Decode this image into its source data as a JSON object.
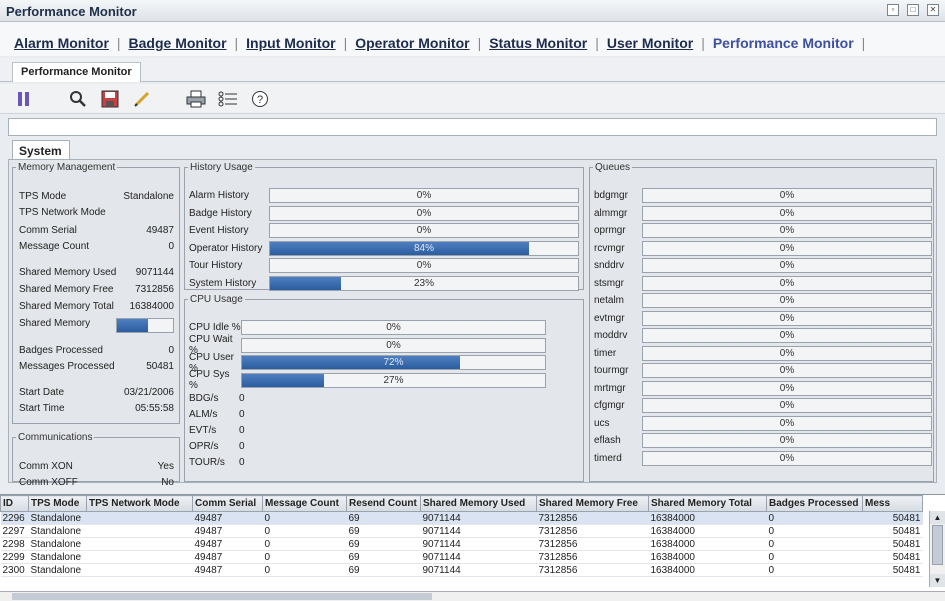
{
  "window": {
    "title": "Performance Monitor"
  },
  "nav": {
    "links": [
      "Alarm Monitor",
      "Badge Monitor",
      "Input Monitor",
      "Operator Monitor",
      "Status Monitor",
      "User Monitor",
      "Performance Monitor"
    ],
    "active": "Performance Monitor",
    "separator": "|"
  },
  "tabs": [
    {
      "label": "Performance Monitor"
    }
  ],
  "toolbar": {
    "icons": [
      "pause-icon",
      "search-icon",
      "save-icon",
      "edit-icon",
      "print-icon",
      "list-icon",
      "help-icon"
    ]
  },
  "system_tab": "System",
  "memory": {
    "legend": "Memory Management",
    "tps_mode_label": "TPS Mode",
    "tps_mode": "Standalone",
    "tps_network_mode_label": "TPS Network Mode",
    "comm_serial_label": "Comm Serial",
    "comm_serial": "49487",
    "message_count_label": "Message Count",
    "message_count": "0",
    "shm_used_label": "Shared Memory Used",
    "shm_used": "9071144",
    "shm_free_label": "Shared Memory Free",
    "shm_free": "7312856",
    "shm_total_label": "Shared Memory Total",
    "shm_total": "16384000",
    "shm_label": "Shared Memory",
    "shm_fraction": 0.55,
    "badges_label": "Badges Processed",
    "badges": "0",
    "messages_label": "Messages Processed",
    "messages": "50481",
    "start_date_label": "Start Date",
    "start_date": "03/21/2006",
    "start_time_label": "Start Time",
    "start_time": "05:55:58"
  },
  "comms": {
    "legend": "Communications",
    "xon_label": "Comm XON",
    "xon": "Yes",
    "xoff_label": "Comm XOFF",
    "xoff": "No"
  },
  "history": {
    "legend": "History Usage",
    "rows": [
      {
        "label": "Alarm History",
        "pct": "0%",
        "value": 0
      },
      {
        "label": "Badge History",
        "pct": "0%",
        "value": 0
      },
      {
        "label": "Event History",
        "pct": "0%",
        "value": 0
      },
      {
        "label": "Operator History",
        "pct": "84%",
        "value": 84
      },
      {
        "label": "Tour History",
        "pct": "0%",
        "value": 0
      },
      {
        "label": "System History",
        "pct": "23%",
        "value": 23
      }
    ]
  },
  "cpu": {
    "legend": "CPU Usage",
    "rows": [
      {
        "label": "CPU Idle %",
        "pct": "0%",
        "value": 0
      },
      {
        "label": "CPU Wait %",
        "pct": "0%",
        "value": 0
      },
      {
        "label": "CPU User %",
        "pct": "72%",
        "value": 72
      },
      {
        "label": "CPU Sys %",
        "pct": "27%",
        "value": 27
      }
    ],
    "stats": [
      {
        "label": "BDG/s",
        "value": "0"
      },
      {
        "label": "ALM/s",
        "value": "0"
      },
      {
        "label": "EVT/s",
        "value": "0"
      },
      {
        "label": "OPR/s",
        "value": "0"
      },
      {
        "label": "TOUR/s",
        "value": "0"
      }
    ]
  },
  "queues": {
    "legend": "Queues",
    "rows": [
      {
        "label": "bdgmgr",
        "pct": "0%",
        "value": 0
      },
      {
        "label": "almmgr",
        "pct": "0%",
        "value": 0
      },
      {
        "label": "oprmgr",
        "pct": "0%",
        "value": 0
      },
      {
        "label": "rcvmgr",
        "pct": "0%",
        "value": 0
      },
      {
        "label": "snddrv",
        "pct": "0%",
        "value": 0
      },
      {
        "label": "stsmgr",
        "pct": "0%",
        "value": 0
      },
      {
        "label": "netalm",
        "pct": "0%",
        "value": 0
      },
      {
        "label": "evtmgr",
        "pct": "0%",
        "value": 0
      },
      {
        "label": "moddrv",
        "pct": "0%",
        "value": 0
      },
      {
        "label": "timer",
        "pct": "0%",
        "value": 0
      },
      {
        "label": "tourmgr",
        "pct": "0%",
        "value": 0
      },
      {
        "label": "mrtmgr",
        "pct": "0%",
        "value": 0
      },
      {
        "label": "cfgmgr",
        "pct": "0%",
        "value": 0
      },
      {
        "label": "ucs",
        "pct": "0%",
        "value": 0
      },
      {
        "label": "eflash",
        "pct": "0%",
        "value": 0
      },
      {
        "label": "timerd",
        "pct": "0%",
        "value": 0
      }
    ]
  },
  "table": {
    "columns": [
      "ID",
      "TPS Mode",
      "TPS Network Mode",
      "Comm Serial",
      "Message Count",
      "Resend Count",
      "Shared Memory Used",
      "Shared Memory Free",
      "Shared Memory Total",
      "Badges Processed",
      "Mess"
    ],
    "rows": [
      [
        "2296",
        "Standalone",
        "",
        "49487",
        "0",
        "69",
        "9071144",
        "7312856",
        "16384000",
        "0",
        "50481"
      ],
      [
        "2297",
        "Standalone",
        "",
        "49487",
        "0",
        "69",
        "9071144",
        "7312856",
        "16384000",
        "0",
        "50481"
      ],
      [
        "2298",
        "Standalone",
        "",
        "49487",
        "0",
        "69",
        "9071144",
        "7312856",
        "16384000",
        "0",
        "50481"
      ],
      [
        "2299",
        "Standalone",
        "",
        "49487",
        "0",
        "69",
        "9071144",
        "7312856",
        "16384000",
        "0",
        "50481"
      ],
      [
        "2300",
        "Standalone",
        "",
        "49487",
        "0",
        "69",
        "9071144",
        "7312856",
        "16384000",
        "0",
        "50481"
      ]
    ]
  }
}
